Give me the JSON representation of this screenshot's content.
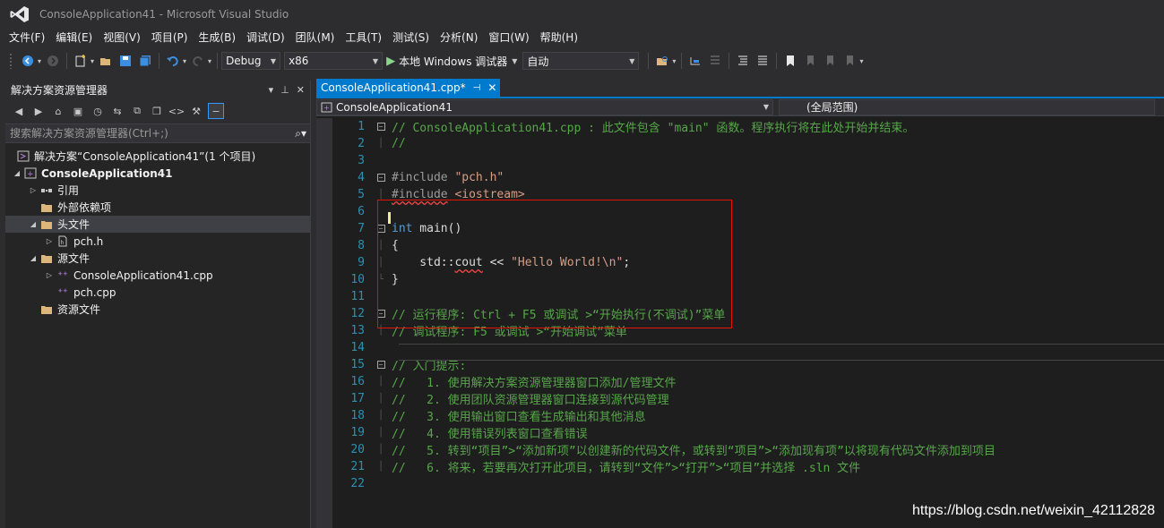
{
  "window": {
    "title": "ConsoleApplication41 - Microsoft Visual Studio"
  },
  "menu": [
    "文件(F)",
    "编辑(E)",
    "视图(V)",
    "项目(P)",
    "生成(B)",
    "调试(D)",
    "团队(M)",
    "工具(T)",
    "测试(S)",
    "分析(N)",
    "窗口(W)",
    "帮助(H)"
  ],
  "toolbar": {
    "configuration": "Debug",
    "platform": "x86",
    "run_label": "本地 Windows 调试器",
    "run_mode": "自动"
  },
  "solution_explorer": {
    "title": "解决方案资源管理器",
    "search_placeholder": "搜索解决方案资源管理器(Ctrl+;)",
    "tree": [
      {
        "label": "解决方案“ConsoleApplication41”(1 个项目)",
        "icon": "solution-icon"
      },
      {
        "label": "ConsoleApplication41",
        "icon": "cpp-project-icon"
      },
      {
        "label": "引用",
        "icon": "references-icon"
      },
      {
        "label": "外部依赖项",
        "icon": "folder-icon"
      },
      {
        "label": "头文件",
        "icon": "folder-icon"
      },
      {
        "label": "pch.h",
        "icon": "header-file-icon"
      },
      {
        "label": "源文件",
        "icon": "folder-icon"
      },
      {
        "label": "ConsoleApplication41.cpp",
        "icon": "cpp-file-icon"
      },
      {
        "label": "pch.cpp",
        "icon": "cpp-file-icon"
      },
      {
        "label": "资源文件",
        "icon": "folder-icon"
      }
    ]
  },
  "editor": {
    "tab_label": "ConsoleApplication41.cpp*",
    "nav_project": "ConsoleApplication41",
    "nav_scope": "(全局范围)",
    "lines": {
      "l1": "// ConsoleApplication41.cpp : 此文件包含 \"main\" 函数。程序执行将在此处开始并结束。",
      "l2": "//",
      "l4a": "#include ",
      "l4b": "\"pch.h\"",
      "l5a": "#include",
      "l5b": " <iostream>",
      "l7a": "int",
      "l7b": " main",
      "l7c": "()",
      "l8": "{",
      "l9a": "    std::",
      "l9b": "cout",
      "l9c": " << ",
      "l9d": "\"Hello World!\\n\"",
      "l9e": ";",
      "l10": "}",
      "l12": "// 运行程序: Ctrl + F5 或调试 >“开始执行(不调试)”菜单",
      "l13": "// 调试程序: F5 或调试 >“开始调试”菜单",
      "l15": "// 入门提示:",
      "l16": "//   1. 使用解决方案资源管理器窗口添加/管理文件",
      "l17": "//   2. 使用团队资源管理器窗口连接到源代码管理",
      "l18": "//   3. 使用输出窗口查看生成输出和其他消息",
      "l19": "//   4. 使用错误列表窗口查看错误",
      "l20": "//   5. 转到“项目”>“添加新项”以创建新的代码文件，或转到“项目”>“添加现有项”以将现有代码文件添加到项目",
      "l21": "//   6. 将来，若要再次打开此项目，请转到“文件”>“打开”>“项目”并选择 .sln 文件"
    },
    "line_numbers": [
      "1",
      "2",
      "3",
      "4",
      "5",
      "6",
      "7",
      "8",
      "9",
      "10",
      "11",
      "12",
      "13",
      "14",
      "15",
      "16",
      "17",
      "18",
      "19",
      "20",
      "21",
      "22"
    ]
  },
  "watermark": "https://blog.csdn.net/weixin_42112828"
}
